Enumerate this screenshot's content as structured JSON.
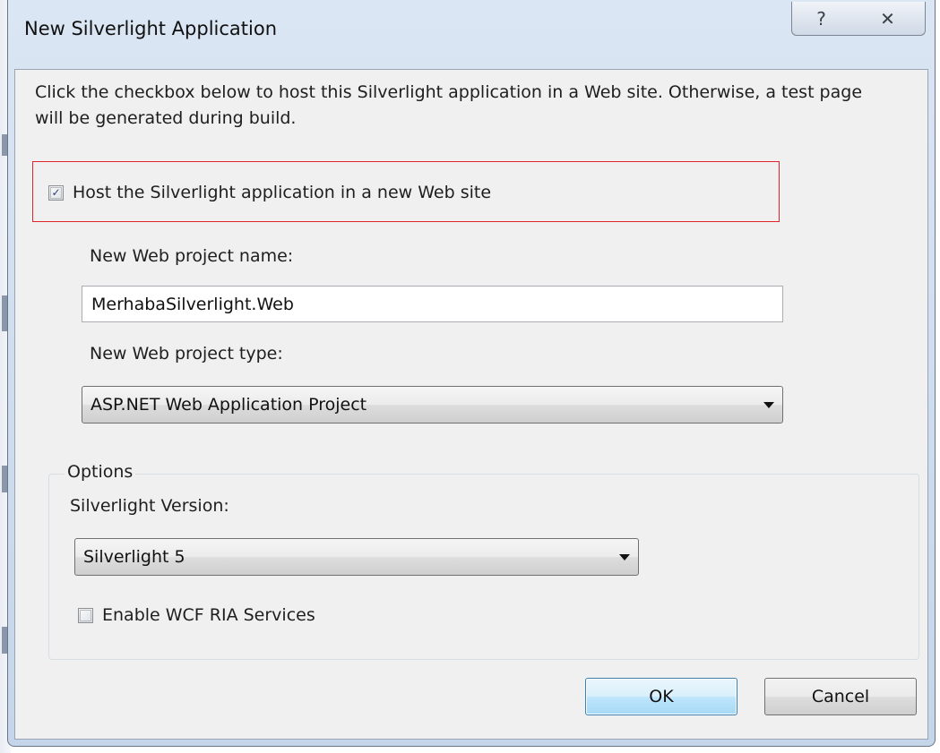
{
  "window": {
    "title": "New Silverlight Application",
    "help_glyph": "?",
    "close_glyph": "✕"
  },
  "info_text": "Click the checkbox below to host this Silverlight application in a Web site. Otherwise, a test page will be generated during build.",
  "host_checkbox": {
    "label": "Host the Silverlight application in a new Web site",
    "checked": true
  },
  "project_name": {
    "label": "New Web project name:",
    "value": "MerhabaSilverlight.Web"
  },
  "project_type": {
    "label": "New Web project type:",
    "selected": "ASP.NET Web Application Project"
  },
  "options": {
    "group_label": "Options",
    "version_label": "Silverlight Version:",
    "version_selected": "Silverlight 5",
    "ria_checkbox": {
      "label": "Enable WCF RIA Services",
      "checked": false
    }
  },
  "buttons": {
    "ok": "OK",
    "cancel": "Cancel"
  },
  "icons": {
    "check": "✓"
  },
  "colors": {
    "highlight_border": "#e0242c",
    "ok_button_border": "#3c7fb1"
  }
}
